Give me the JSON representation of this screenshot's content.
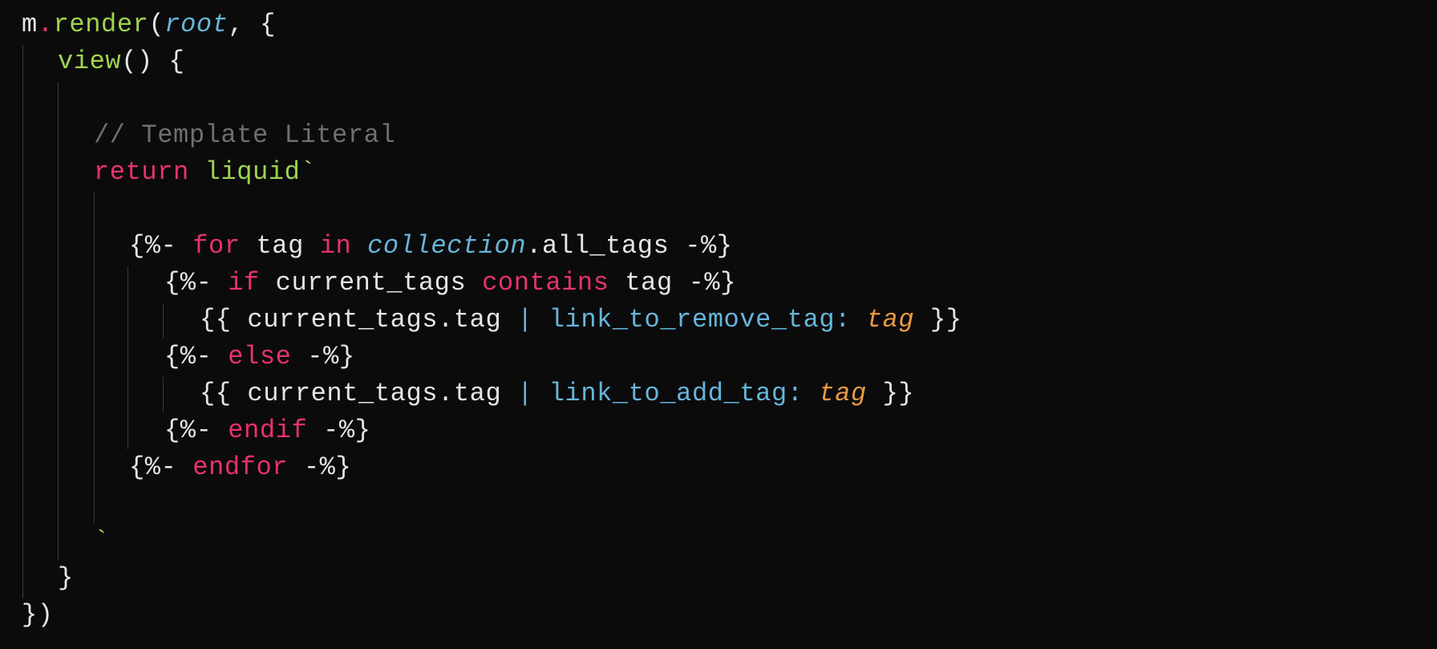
{
  "code": {
    "l1": {
      "obj": "m",
      "dot": ".",
      "fn": "render",
      "paren_open": "(",
      "arg": "root",
      "rest": ", {"
    },
    "l2": {
      "fn": "view",
      "rest": "() {"
    },
    "l4": {
      "comment": "// Template Literal"
    },
    "l5": {
      "kw": "return",
      "tag": "liquid",
      "tick": "`"
    },
    "l7": {
      "open": "{%-",
      "kw_for": "for",
      "var": "tag",
      "kw_in": "in",
      "obj": "collection",
      "prop": ".all_tags",
      "close": "-%}"
    },
    "l8": {
      "open": "{%-",
      "kw_if": "if",
      "var": "current_tags",
      "kw_contains": "contains",
      "var2": "tag",
      "close": "-%}"
    },
    "l9": {
      "open": "{{",
      "expr": "current_tags.tag",
      "pipe": "|",
      "filter": "link_to_remove_tag:",
      "arg": "tag",
      "close": "}}"
    },
    "l10": {
      "open": "{%-",
      "kw": "else",
      "close": "-%}"
    },
    "l11": {
      "open": "{{",
      "expr": "current_tags.tag",
      "pipe": "|",
      "filter": "link_to_add_tag:",
      "arg": "tag",
      "close": "}}"
    },
    "l12": {
      "open": "{%-",
      "kw": "endif",
      "close": "-%}"
    },
    "l13": {
      "open": "{%-",
      "kw": "endfor",
      "close": "-%}"
    },
    "l15": {
      "tick": "`"
    },
    "l16": {
      "brace": "}"
    },
    "l17": {
      "close": "})"
    }
  },
  "colors": {
    "background": "#0b0b0c",
    "keyword": "#e8326c",
    "function": "#9fd44f",
    "filter": "#66b6d9",
    "parameter": "#e99a43",
    "comment": "#6f6f6f"
  }
}
